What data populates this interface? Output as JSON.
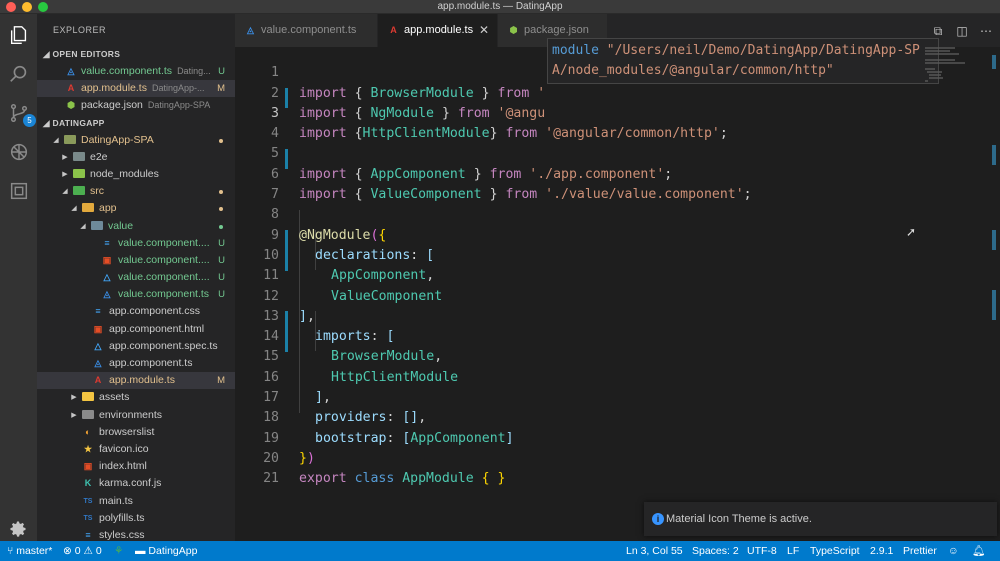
{
  "window": {
    "title": "app.module.ts — DatingApp"
  },
  "activity": {
    "scm_badge": "5"
  },
  "sidebar": {
    "title": "EXPLORER",
    "open_editors_label": "OPEN EDITORS",
    "open_editors": [
      {
        "name": "value.component.ts",
        "desc": "Dating...",
        "status": "U"
      },
      {
        "name": "app.module.ts",
        "desc": "DatingApp-...",
        "status": "M"
      },
      {
        "name": "package.json",
        "desc": "DatingApp-SPA",
        "status": ""
      }
    ],
    "workspace_label": "DATINGAPP",
    "tree": [
      {
        "name": "DatingApp-SPA"
      },
      {
        "name": "e2e"
      },
      {
        "name": "node_modules"
      },
      {
        "name": "src"
      },
      {
        "name": "app"
      },
      {
        "name": "value"
      },
      {
        "name": "value.component....",
        "status": "U"
      },
      {
        "name": "value.component....",
        "status": "U"
      },
      {
        "name": "value.component....",
        "status": "U"
      },
      {
        "name": "value.component.ts",
        "status": "U"
      },
      {
        "name": "app.component.css"
      },
      {
        "name": "app.component.html"
      },
      {
        "name": "app.component.spec.ts"
      },
      {
        "name": "app.component.ts"
      },
      {
        "name": "app.module.ts",
        "status": "M"
      },
      {
        "name": "assets"
      },
      {
        "name": "environments"
      },
      {
        "name": "browserslist"
      },
      {
        "name": "favicon.ico"
      },
      {
        "name": "index.html"
      },
      {
        "name": "karma.conf.js"
      },
      {
        "name": "main.ts"
      },
      {
        "name": "polyfills.ts"
      },
      {
        "name": "styles.css"
      }
    ]
  },
  "tabs": [
    {
      "label": "value.component.ts"
    },
    {
      "label": "app.module.ts",
      "close": "✕"
    },
    {
      "label": "package.json"
    }
  ],
  "editor": {
    "line_numbers": [
      "1",
      "2",
      "3",
      "4",
      "5",
      "6",
      "7",
      "8",
      "9",
      "10",
      "11",
      "12",
      "13",
      "14",
      "15",
      "16",
      "17",
      "18",
      "19",
      "20",
      "21"
    ],
    "code": {
      "l1": {
        "kw": "import",
        "a": " { ",
        "t": "BrowserModule",
        "b": " } ",
        "from": "from",
        "s": " '"
      },
      "l2": {
        "kw": "import",
        "a": " { ",
        "t": "NgModule",
        "b": " } ",
        "from": "from",
        "s": " '@angu"
      },
      "l3": {
        "kw": "import",
        "a": " {",
        "t": "HttpClientModule",
        "b": "} ",
        "from": "from",
        "s": " '@angular/common/http'",
        "end": ";"
      },
      "l5": {
        "kw": "import",
        "a": " { ",
        "t": "AppComponent",
        "b": " } ",
        "from": "from",
        "s": " './app.component'",
        "end": ";"
      },
      "l6": {
        "kw": "import",
        "a": " { ",
        "t": "ValueComponent",
        "b": " } ",
        "from": "from",
        "s": " './value/value.component'",
        "end": ";"
      },
      "l8": {
        "at": "@NgModule",
        "p": "(",
        "b": "{"
      },
      "l9": {
        "prop": "declarations",
        "c": ": ",
        "b": "["
      },
      "l10": {
        "t": "AppComponent",
        "c": ","
      },
      "l11": {
        "t": "ValueComponent"
      },
      "l12": {
        "b": "]",
        "c": ","
      },
      "l13": {
        "prop": "imports",
        "c": ": ",
        "b": "["
      },
      "l14": {
        "t": "BrowserModule",
        "c": ","
      },
      "l15": {
        "t": "HttpClientModule"
      },
      "l16": {
        "b": "]",
        "c": ","
      },
      "l17": {
        "prop": "providers",
        "c": ": ",
        "v": "[]",
        "e": ","
      },
      "l18": {
        "prop": "bootstrap",
        "c": ": ",
        "o": "[",
        "t": "AppComponent",
        "cl": "]"
      },
      "l19": {
        "b": "}",
        "p": ")"
      },
      "l20": {
        "kw": "export",
        "kw2": " class ",
        "t": "AppModule",
        "b": " { }"
      }
    },
    "hover": {
      "keyword": "module",
      "line1": " \"/Users/neil/Demo/DatingApp/DatingApp-SP",
      "line2": "A/node_modules/@angular/common/http\""
    }
  },
  "notification": {
    "text": "Material Icon Theme is active."
  },
  "statusbar": {
    "branch": "master*",
    "errors": "0",
    "warnings": "0",
    "folder": "DatingApp",
    "position": "Ln 3, Col 55",
    "spaces": "Spaces: 2",
    "encoding": "UTF-8",
    "eol": "LF",
    "language": "TypeScript",
    "version": "2.9.1",
    "formatter": "Prettier"
  },
  "colors": {
    "statusbar": "#007acc",
    "angular_red": "#dd3a31",
    "typescript_blue": "#3178c6"
  }
}
